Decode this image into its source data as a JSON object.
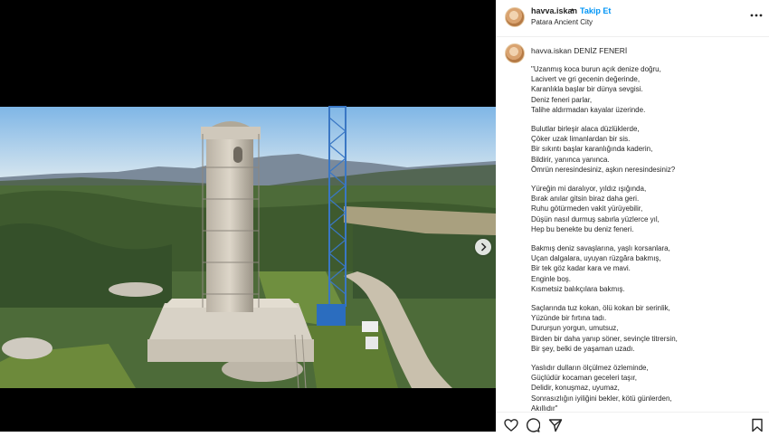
{
  "post": {
    "username": "havva.iskan",
    "separator": "•",
    "follow_label": "Takip Et",
    "location": "Patara Ancient City",
    "caption_title": "DENİZ FENERİ"
  },
  "poem": [
    [
      "\"Uzanmış koca burun açık denize doğru,",
      "Lacivert ve gri gecenin değerinde,",
      "Karanlıkla başlar bir dünya sevgisi.",
      "Deniz feneri parlar,",
      "Talihe aldırmadan kayalar üzerinde."
    ],
    [
      "Bulutlar birleşir alaca düzlüklerde,",
      "Çöker uzak limanlardan bir sis.",
      "Bir sıkıntı başlar karanlığında kaderin,",
      "Bildirir, yanınca yanınca.",
      "Ömrün neresindesiniz, aşkın neresindesiniz?"
    ],
    [
      "Yüreğin mi daralıyor, yıldız ışığında,",
      "Bırak anılar gitsin biraz daha geri.",
      "Ruhu götürmeden vakit yürüyebilir,",
      "Düşün nasıl durmuş sabırla yüzlerce yıl,",
      "Hep bu benekte bu deniz feneri."
    ],
    [
      "Bakmış deniz savaşlarına, yaşlı korsanlara,",
      "Uçan dalgalara, uyuyan rüzgâra bakmış,",
      "Bir tek göz kadar kara ve mavi.",
      "Enginle boş.",
      "Kısmetsiz balıkçılara bakmış."
    ],
    [
      "Saçlarında tuz kokan, ölü kokan bir serinlik,",
      "Yüzünde bir fırtına tadı.",
      "Dururşun yorgun, umutsuz,",
      "Birden bir daha yanıp söner, sevinçle titrersin,",
      "Bir şey, belki de yaşaman uzadı."
    ],
    [
      "Yaslıdır dulların ölçülmez özleminde,",
      "Güçlüdür kocaman geceleri taşır,",
      "Delidir, konuşmaz, uyumaz,",
      "Sonrasızlığın iyiliğini bekler, kötü günlerden,",
      "Akıllıdır\""
    ]
  ],
  "icons": {
    "more": "more-horizontal-icon",
    "next": "chevron-right-icon",
    "like": "heart-icon",
    "comment": "comment-icon",
    "share": "paper-plane-icon",
    "save": "bookmark-icon"
  },
  "colors": {
    "link_blue": "#0095f6",
    "text": "#262626",
    "divider": "#efefef"
  }
}
